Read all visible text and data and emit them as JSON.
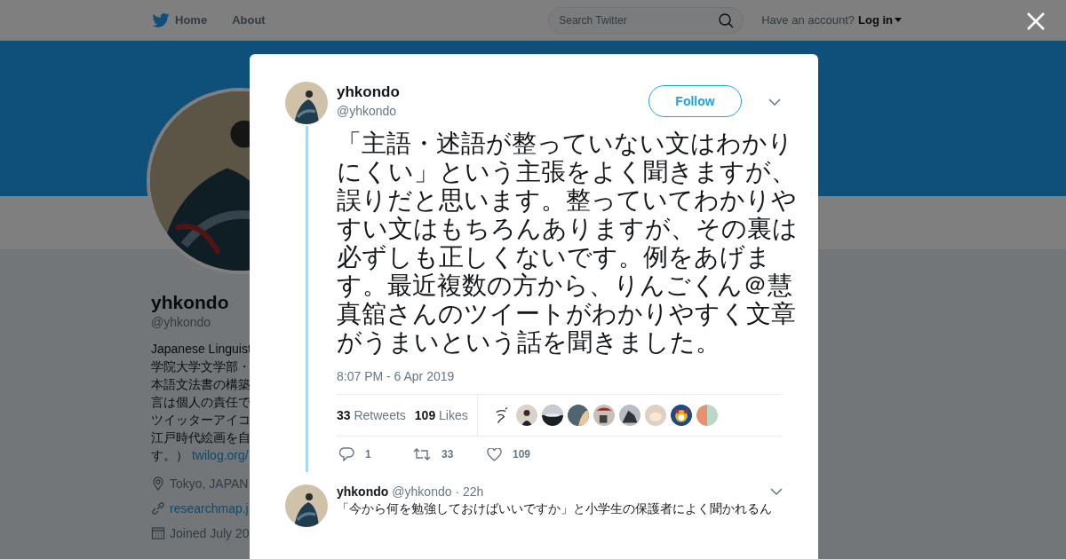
{
  "nav": {
    "items": [
      {
        "label": "Home"
      },
      {
        "label": "About"
      }
    ],
    "search": {
      "placeholder": "Search Twitter"
    },
    "account_prompt": "Have an account?",
    "login": "Log in"
  },
  "profile": {
    "name": "yhkondo",
    "handle": "@yhkondo",
    "bio_lines": [
      "Japanese Linguist",
      "学院大学文学部・",
      "本語文法書の構築",
      "言は個人の責任で",
      "ツイッターアイコ",
      "江戸時代絵画を自"
    ],
    "bio_last": "す。）",
    "bio_link": "twilog.org/",
    "location": "Tokyo, JAPAN",
    "website": "researchmap.j",
    "joined": "Joined July 20"
  },
  "tweet": {
    "name": "yhkondo",
    "handle": "@yhkondo",
    "follow": "Follow",
    "text": "「主語・述語が整っていない文はわかりにくい」という主張をよく聞きますが、誤りだと思います。整っていてわかりやすい文はもちろんありますが、その裏は必ずしも正しくないです。例をあげます。最近複数の方から、りんごくん＠慧真舘さんのツイートがわかりやすく文章がうまいという話を聞きました。",
    "time": "8:07 PM - 6 Apr 2019",
    "retweets_count": "33",
    "retweets_label": "Retweets",
    "likes_count": "109",
    "likes_label": "Likes",
    "replies": "1",
    "retweets": "33",
    "likes": "109"
  },
  "reply": {
    "name": "yhkondo",
    "handle": "@yhkondo",
    "time": "· 22h",
    "text": "「今から何を勉強しておけばいいですか」と小学生の保護者によく聞かれるん"
  }
}
